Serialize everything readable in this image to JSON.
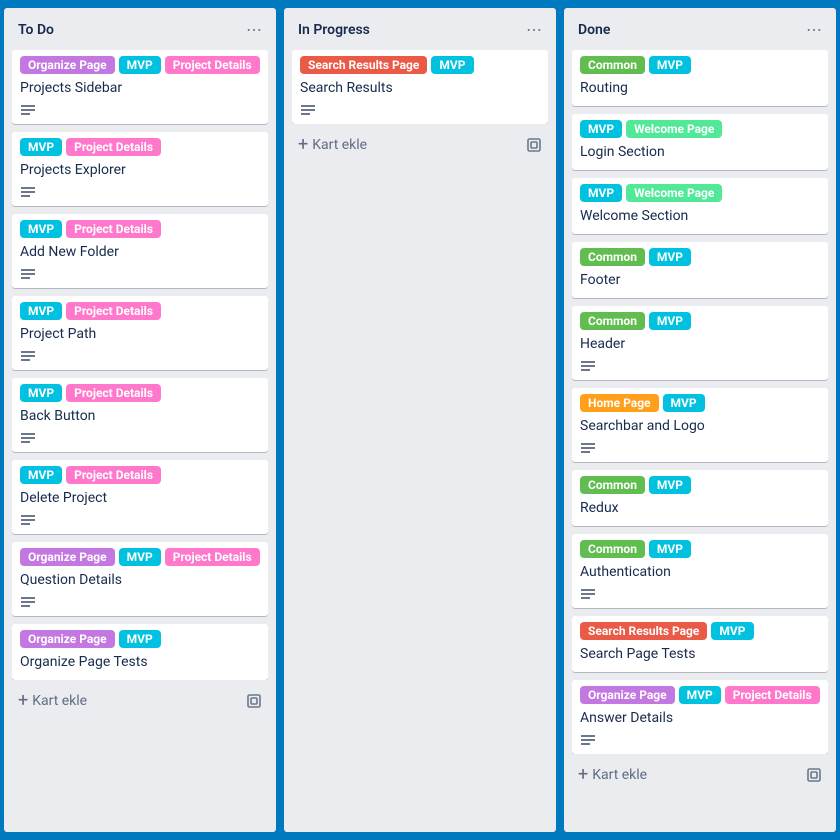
{
  "addCardLabel": "Kart ekle",
  "labelColors": {
    "Organize Page": "c-purple",
    "MVP": "c-sky",
    "Project Details": "c-pink",
    "Search Results Page": "c-red",
    "Common": "c-green",
    "Welcome Page": "c-lime",
    "Home Page": "c-orange"
  },
  "lists": [
    {
      "title": "To Do",
      "cards": [
        {
          "labels": [
            "Organize Page",
            "MVP",
            "Project Details"
          ],
          "title": "Projects Sidebar",
          "desc": true
        },
        {
          "labels": [
            "MVP",
            "Project Details"
          ],
          "title": "Projects Explorer",
          "desc": true
        },
        {
          "labels": [
            "MVP",
            "Project Details"
          ],
          "title": "Add New Folder",
          "desc": true
        },
        {
          "labels": [
            "MVP",
            "Project Details"
          ],
          "title": "Project Path",
          "desc": true
        },
        {
          "labels": [
            "MVP",
            "Project Details"
          ],
          "title": "Back Button",
          "desc": true
        },
        {
          "labels": [
            "MVP",
            "Project Details"
          ],
          "title": "Delete Project",
          "desc": true
        },
        {
          "labels": [
            "Organize Page",
            "MVP",
            "Project Details"
          ],
          "title": "Question Details",
          "desc": true
        },
        {
          "labels": [
            "Organize Page",
            "MVP"
          ],
          "title": "Organize Page Tests",
          "desc": false
        }
      ]
    },
    {
      "title": "In Progress",
      "cards": [
        {
          "labels": [
            "Search Results Page",
            "MVP"
          ],
          "title": "Search Results",
          "desc": true
        }
      ]
    },
    {
      "title": "Done",
      "cards": [
        {
          "labels": [
            "Common",
            "MVP"
          ],
          "title": "Routing",
          "desc": false
        },
        {
          "labels": [
            "MVP",
            "Welcome Page"
          ],
          "title": "Login Section",
          "desc": false
        },
        {
          "labels": [
            "MVP",
            "Welcome Page"
          ],
          "title": "Welcome Section",
          "desc": false
        },
        {
          "labels": [
            "Common",
            "MVP"
          ],
          "title": "Footer",
          "desc": false
        },
        {
          "labels": [
            "Common",
            "MVP"
          ],
          "title": "Header",
          "desc": true
        },
        {
          "labels": [
            "Home Page",
            "MVP"
          ],
          "title": "Searchbar and Logo",
          "desc": true
        },
        {
          "labels": [
            "Common",
            "MVP"
          ],
          "title": "Redux",
          "desc": false
        },
        {
          "labels": [
            "Common",
            "MVP"
          ],
          "title": "Authentication",
          "desc": true
        },
        {
          "labels": [
            "Search Results Page",
            "MVP"
          ],
          "title": "Search Page Tests",
          "desc": false
        },
        {
          "labels": [
            "Organize Page",
            "MVP",
            "Project Details"
          ],
          "title": "Answer Details",
          "desc": true
        }
      ]
    }
  ]
}
